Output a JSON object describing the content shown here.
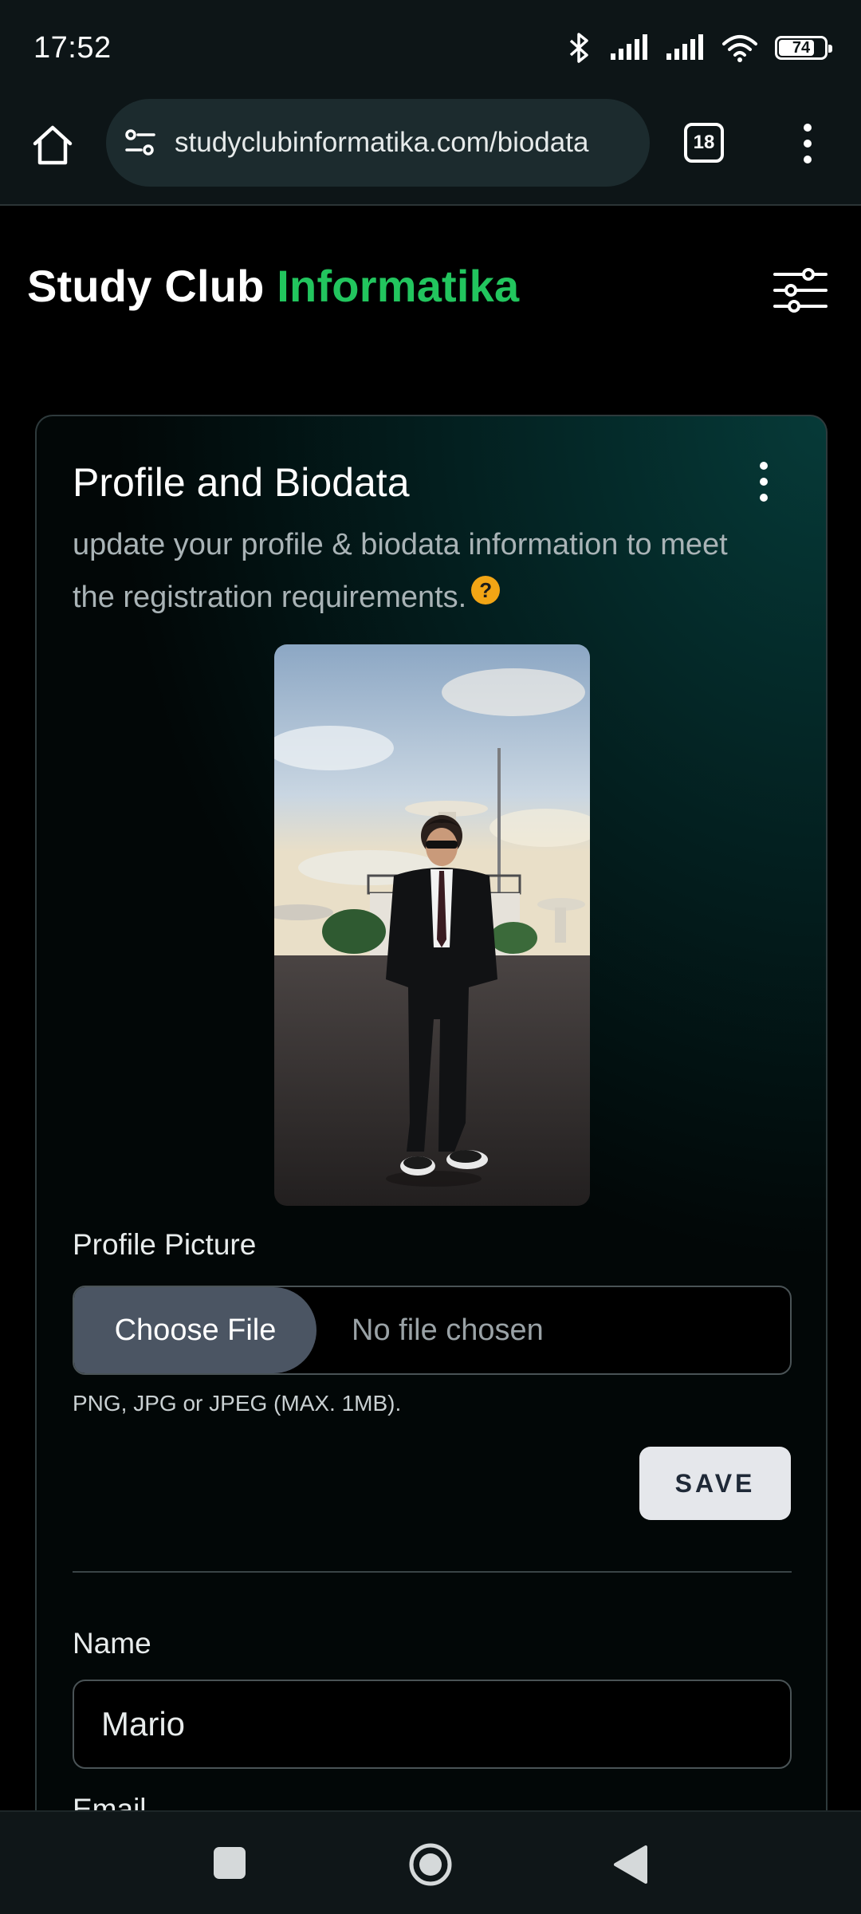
{
  "status_bar": {
    "time": "17:52",
    "battery": "74",
    "icons": [
      "bluetooth-icon",
      "signal-icon",
      "signal-icon",
      "wifi-icon",
      "battery-icon"
    ]
  },
  "browser": {
    "url": "studyclubinformatika.com/biodata",
    "tab_count": "18",
    "icons": [
      "home-icon",
      "site-settings-icon",
      "tabs-icon",
      "more-vert-icon"
    ]
  },
  "header": {
    "brand_primary": "Study Club",
    "brand_accent": "Informatika",
    "accent_color": "#22c55e",
    "filter_icon": "sliders-icon"
  },
  "card": {
    "title": "Profile and Biodata",
    "description": "update your profile & biodata information to meet the registration requirements.",
    "help_glyph": "?",
    "profile_picture": {
      "label": "Profile Picture",
      "choose_label": "Choose File",
      "status": "No file chosen",
      "hint": "PNG, JPG or JPEG (MAX. 1MB)."
    },
    "save_label": "SAVE",
    "name": {
      "label": "Name",
      "value": "Mario"
    },
    "email": {
      "label": "Email"
    }
  },
  "nav_bar": {
    "icons": [
      "recents-icon",
      "home-circle-icon",
      "back-icon"
    ]
  }
}
